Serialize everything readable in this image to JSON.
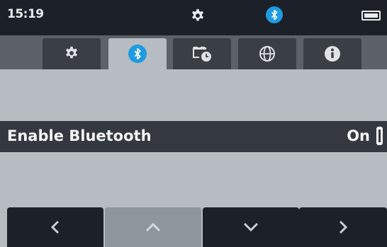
{
  "status_bar": {
    "time": "15:19",
    "icons": [
      "gear-icon",
      "bluetooth-icon",
      "battery-icon"
    ]
  },
  "tabs": [
    {
      "id": "general",
      "icon": "gear-icon",
      "active": false
    },
    {
      "id": "bluetooth",
      "icon": "bluetooth-icon",
      "active": true
    },
    {
      "id": "date-time",
      "icon": "calendar-clock-icon",
      "active": false
    },
    {
      "id": "language",
      "icon": "globe-icon",
      "active": false
    },
    {
      "id": "info",
      "icon": "info-icon",
      "active": false
    }
  ],
  "settings": {
    "enable_bluetooth": {
      "label": "Enable Bluetooth",
      "value": "On"
    }
  },
  "softkeys": [
    "chevron-left-icon",
    "chevron-up-icon",
    "chevron-down-icon",
    "chevron-right-icon"
  ],
  "colors": {
    "dark": "#1c2029",
    "panel": "#b6bcc2",
    "bluetooth_blue": "#1e9be0",
    "row_highlight": "#343841"
  }
}
